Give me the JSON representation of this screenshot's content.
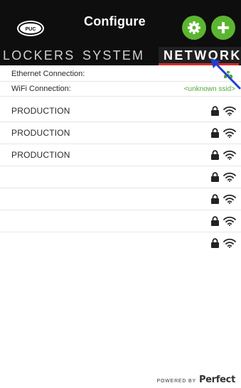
{
  "header": {
    "title": "Configure",
    "logo_text": "PUC",
    "settings_icon": "gear-icon",
    "add_icon": "plus-icon",
    "accent_color": "#5cb531"
  },
  "tabs": [
    {
      "label": "LOCKERS",
      "active": false
    },
    {
      "label": "SYSTEM",
      "active": false
    },
    {
      "label": "NETWORK",
      "active": true
    }
  ],
  "tab_underline_color": "#d62c2c",
  "connections": {
    "ethernet": {
      "label": "Ethernet Connection:",
      "status_icon": "ethernet-icon"
    },
    "wifi": {
      "label": "WiFi Connection:",
      "value": "<unknown ssid>"
    }
  },
  "networks": [
    {
      "name": "PRODUCTION",
      "secured": true,
      "signal_icon": "wifi-icon"
    },
    {
      "name": "PRODUCTION",
      "secured": true,
      "signal_icon": "wifi-icon"
    },
    {
      "name": "PRODUCTION",
      "secured": true,
      "signal_icon": "wifi-icon"
    },
    {
      "name": "",
      "secured": true,
      "signal_icon": "wifi-icon"
    },
    {
      "name": "",
      "secured": true,
      "signal_icon": "wifi-icon"
    },
    {
      "name": "",
      "secured": true,
      "signal_icon": "wifi-icon"
    },
    {
      "name": "",
      "secured": true,
      "signal_icon": "wifi-icon"
    }
  ],
  "footer": {
    "powered_by": "POWERED BY",
    "brand": "Perfect"
  }
}
